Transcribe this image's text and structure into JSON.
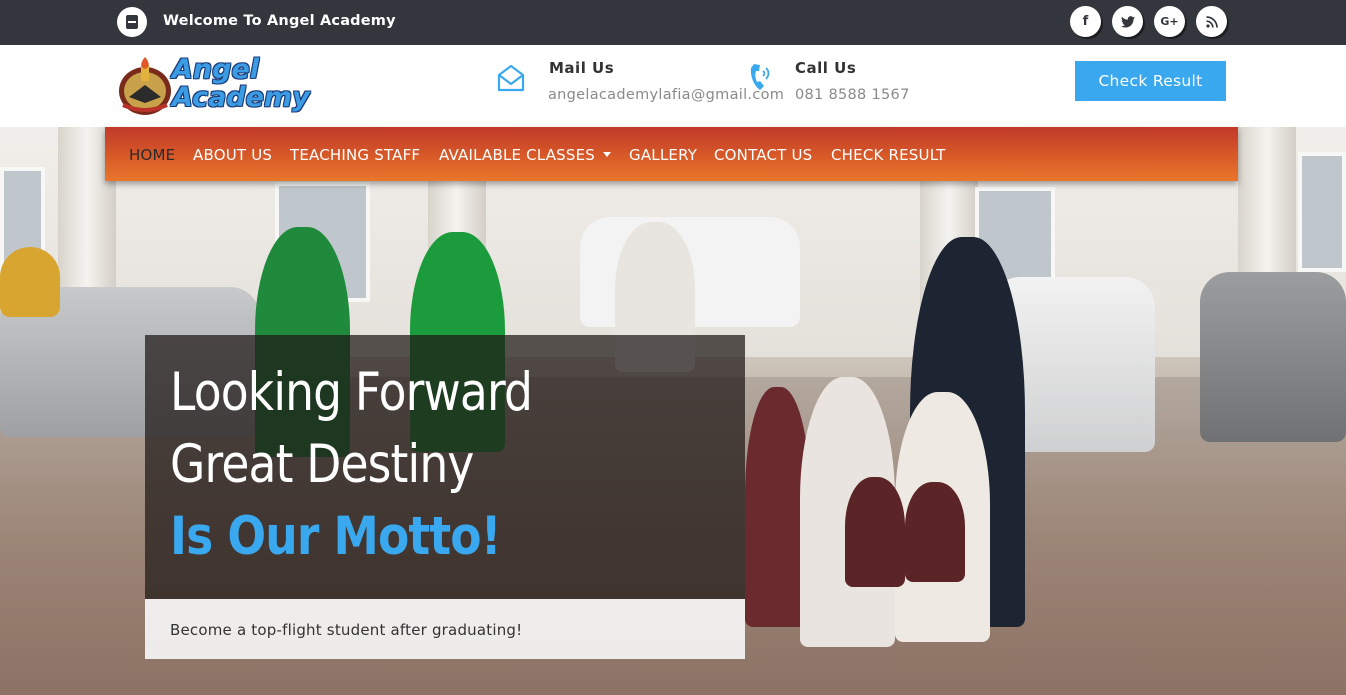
{
  "topbar": {
    "welcome_text": "Welcome To Angel Academy",
    "social": [
      {
        "icon": "facebook-icon",
        "glyph": "f"
      },
      {
        "icon": "twitter-icon",
        "glyph": "t"
      },
      {
        "icon": "google-plus-icon",
        "glyph": "G+"
      },
      {
        "icon": "rss-icon",
        "glyph": "∷"
      }
    ]
  },
  "header": {
    "logo_line1": "Angel",
    "logo_line2": "Academy",
    "mail": {
      "label": "Mail Us",
      "value": "angelacademylafia@gmail.com"
    },
    "call": {
      "label": "Call Us",
      "value": "081 8588 1567"
    },
    "check_result_label": "Check Result"
  },
  "nav": {
    "items": [
      {
        "label": "HOME"
      },
      {
        "label": "ABOUT US"
      },
      {
        "label": "TEACHING STAFF"
      },
      {
        "label": "AVAILABLE CLASSES"
      },
      {
        "label": "GALLERY"
      },
      {
        "label": "CONTACT US"
      },
      {
        "label": "CHECK RESULT"
      }
    ]
  },
  "hero": {
    "line1": "Looking Forward",
    "line2": "Great Destiny",
    "line3": "Is Our Motto!",
    "subtitle": "Become a top-flight student after graduating!"
  },
  "colors": {
    "topbar": "#33363d",
    "accent_blue": "#3aa8ee",
    "nav_gradient_start": "#c0392b",
    "nav_gradient_end": "#e8772a"
  }
}
